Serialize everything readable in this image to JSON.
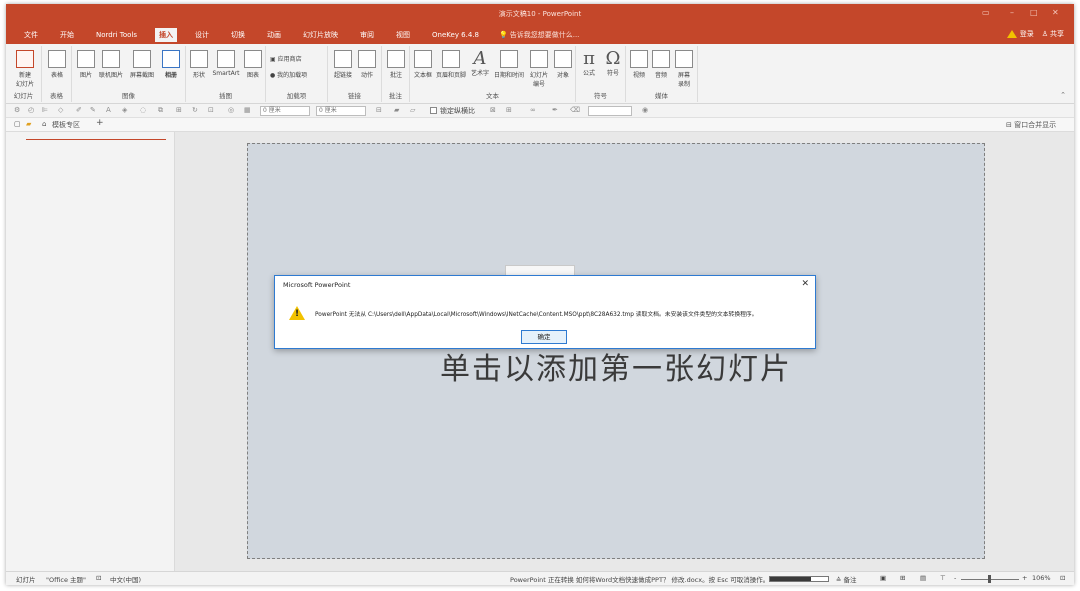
{
  "app": {
    "window_title": "演示文稿10 - PowerPoint",
    "window_controls": [
      "▭",
      "–",
      "□",
      "✕"
    ]
  },
  "tabs": [
    {
      "label": "文件"
    },
    {
      "label": "开始"
    },
    {
      "label": "Nordri Tools"
    },
    {
      "label": "插入",
      "active": true
    },
    {
      "label": "设计"
    },
    {
      "label": "切换"
    },
    {
      "label": "动画"
    },
    {
      "label": "幻灯片放映"
    },
    {
      "label": "审阅"
    },
    {
      "label": "视图"
    },
    {
      "label": "OneKey 6.4.8"
    }
  ],
  "tell_me": "告诉我您想要做什么...",
  "user": {
    "login": "登录",
    "share": "共享"
  },
  "ribbon": {
    "groups": {
      "slides": "幻灯片",
      "tables": "表格",
      "images": "图像",
      "illustrations": "插图",
      "addins": "加载项",
      "links": "链接",
      "comments": "批注",
      "text": "文本",
      "symbols": "符号",
      "media": "媒体"
    },
    "buttons": {
      "new_slide": "新建\n幻灯片",
      "table": "表格",
      "picture": "图片",
      "online_picture": "联机图片",
      "screenshot": "屏幕截图",
      "album": "相册",
      "shapes": "形状",
      "smartart": "SmartArt",
      "chart": "图表",
      "store": "应用商店",
      "my_addins": "我的加载项",
      "hyperlink": "超链接",
      "action": "动作",
      "comment": "批注",
      "textbox": "文本框",
      "header_footer": "页眉和页脚",
      "wordart": "艺术字",
      "datetime": "日期和时间",
      "slide_number": "幻灯片\n编号",
      "object": "对象",
      "equation": "公式",
      "symbol": "符号",
      "video": "视频",
      "audio": "音频",
      "screen_recording": "屏幕\n录制"
    },
    "equation_glyph": "π",
    "symbol_glyph": "Ω"
  },
  "qat": {
    "width_value": "0 厘米",
    "height_value": "0 厘米",
    "lock_ratio": "锁定纵横比"
  },
  "docrow": {
    "template_label": "模板专区",
    "add": "+",
    "window_merge": "窗口合并显示"
  },
  "slide": {
    "placeholder": "单击以添加第一张幻灯片"
  },
  "dialog": {
    "title": "Microsoft PowerPoint",
    "close": "✕",
    "message": "PowerPoint 无法从 C:\\Users\\dell\\AppData\\Local\\Microsoft\\Windows\\INetCache\\Content.MSO\\ppt\\8C28A632.tmp 读取文档。未安装该文件类型的文本转换程序。",
    "ok": "确定",
    "warn_mark": "!"
  },
  "status": {
    "slide": "幻灯片",
    "theme": "\"Office 主题\"",
    "language": "中文(中国)",
    "converting": "PowerPoint 正在转换 如何将Word文档快速做成PPT？ 修改.docx。按 Esc 可取消操作。",
    "progress": 0.7,
    "notes": "备注",
    "zoom": "106%"
  }
}
